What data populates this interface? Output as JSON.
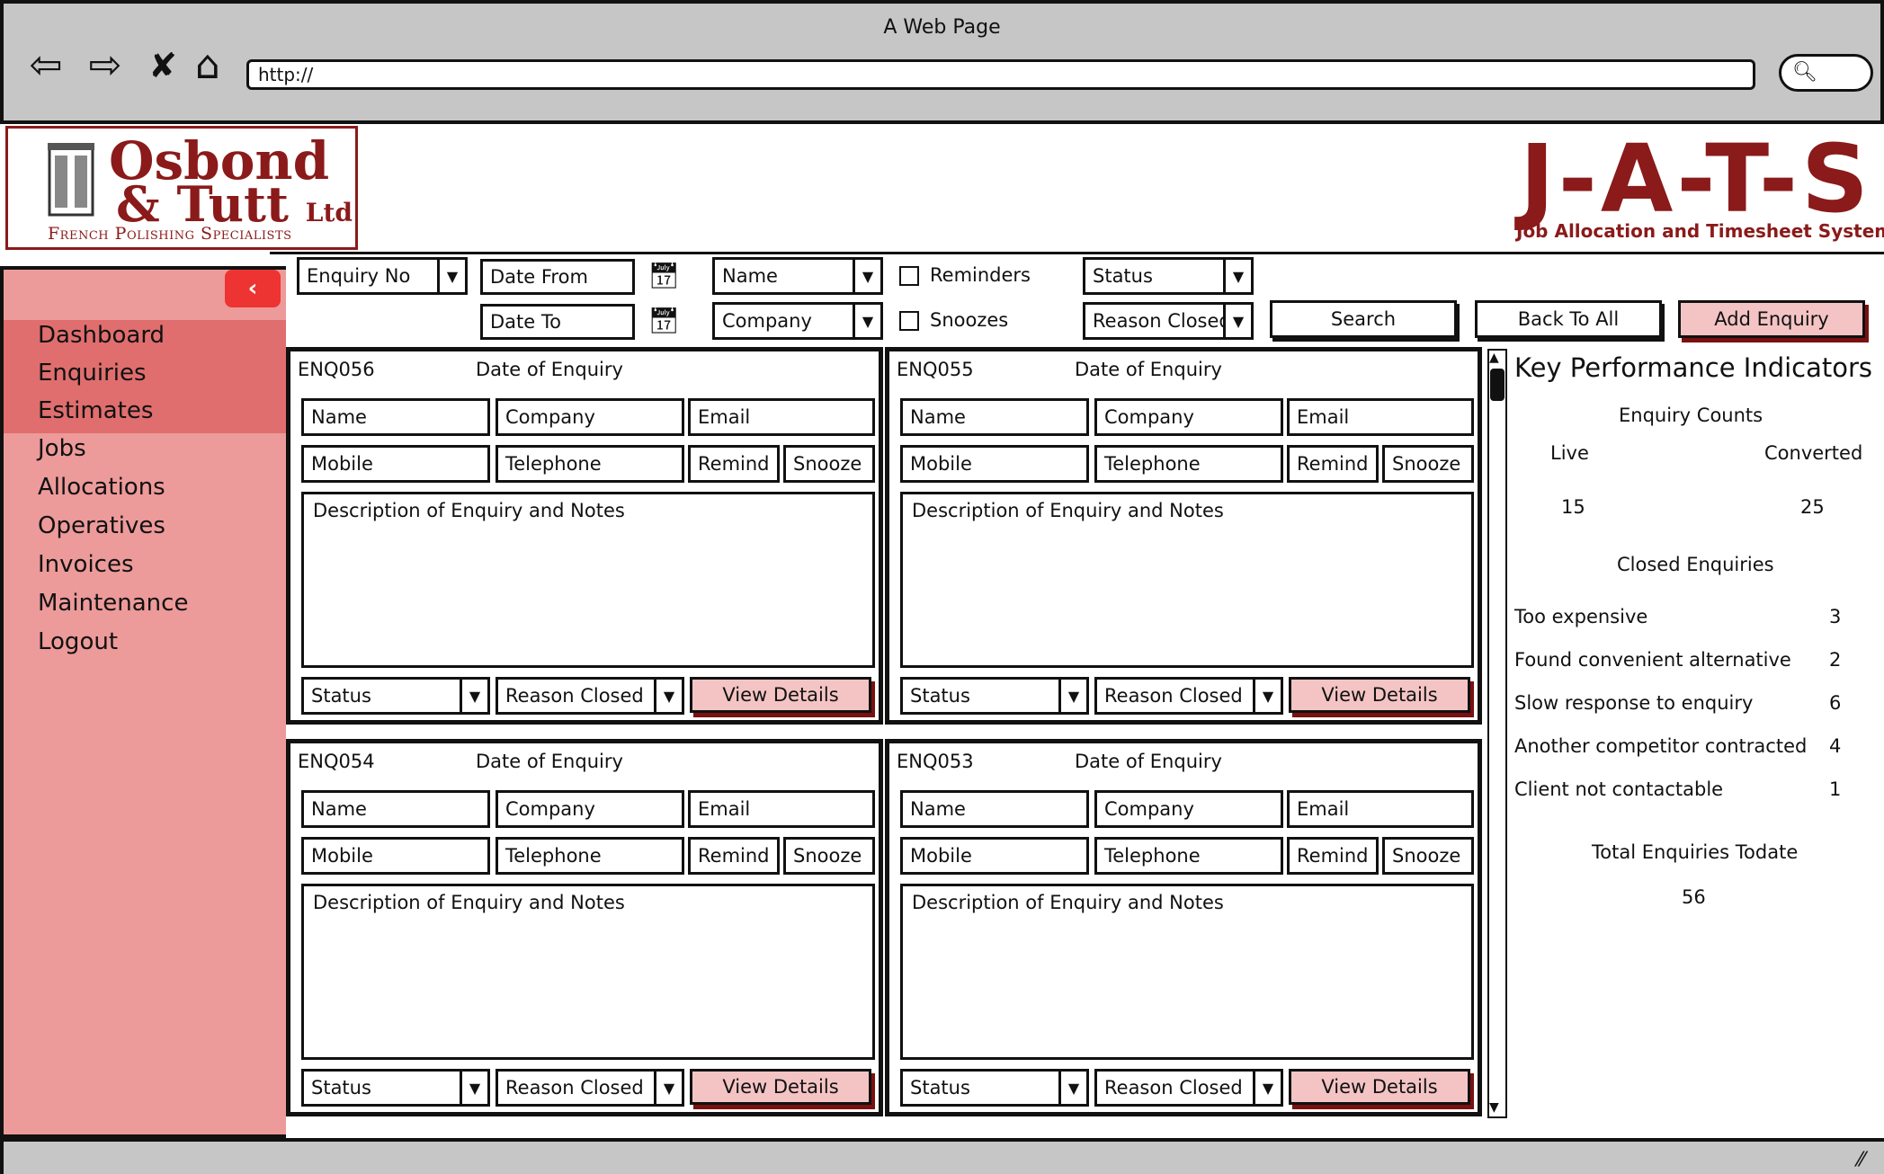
{
  "window": {
    "title": "A Web Page",
    "url": "http://"
  },
  "logo": {
    "line1": "Osbond",
    "line2": "& Tutt",
    "ltd": "Ltd",
    "tagline": "French Polishing Specialists"
  },
  "brand": {
    "title": "J-A-T-S",
    "subtitle": "Job Allocation and Timesheet System"
  },
  "colors": {
    "brand": "#8b1a1a",
    "sidebar": "#ed9a9a",
    "sidebar_selected": "#e06e6e",
    "button_accent": "#f4c4c4"
  },
  "sidebar": {
    "items": [
      {
        "label": "Dashboard"
      },
      {
        "label": "Enquiries"
      },
      {
        "label": "Estimates"
      },
      {
        "label": "Jobs"
      },
      {
        "label": "Allocations"
      },
      {
        "label": "Operatives"
      },
      {
        "label": "Invoices"
      },
      {
        "label": "Maintenance"
      },
      {
        "label": "Logout"
      }
    ]
  },
  "filters": {
    "enquiry_no": "Enquiry No",
    "date_from": "Date From",
    "date_to": "Date To",
    "name": "Name",
    "company": "Company",
    "reminders": "Reminders",
    "snoozes": "Snoozes",
    "status": "Status",
    "reason_closed": "Reason Closed",
    "search": "Search",
    "back_to_all": "Back To All",
    "add_enquiry": "Add Enquiry"
  },
  "card_labels": {
    "date_of_enquiry": "Date of Enquiry",
    "name": "Name",
    "company": "Company",
    "email": "Email",
    "mobile": "Mobile",
    "telephone": "Telephone",
    "remind": "Remind",
    "snooze": "Snooze",
    "description": "Description of Enquiry and Notes",
    "status": "Status",
    "reason_closed": "Reason Closed",
    "view_details": "View Details"
  },
  "cards": [
    {
      "id": "ENQ056"
    },
    {
      "id": "ENQ055"
    },
    {
      "id": "ENQ054"
    },
    {
      "id": "ENQ053"
    }
  ],
  "kpi": {
    "title": "Key Performance Indicators",
    "counts_heading": "Enquiry Counts",
    "live_label": "Live",
    "converted_label": "Converted",
    "live_value": "15",
    "converted_value": "25",
    "closed_heading": "Closed Enquiries",
    "closed_reasons": [
      {
        "reason": "Too expensive",
        "count": "3"
      },
      {
        "reason": "Found convenient alternative",
        "count": "2"
      },
      {
        "reason": "Slow response to enquiry",
        "count": "6"
      },
      {
        "reason": "Another competitor contracted",
        "count": "4"
      },
      {
        "reason": "Client not contactable",
        "count": "1"
      }
    ],
    "total_heading": "Total Enquiries Todate",
    "total_value": "56"
  }
}
